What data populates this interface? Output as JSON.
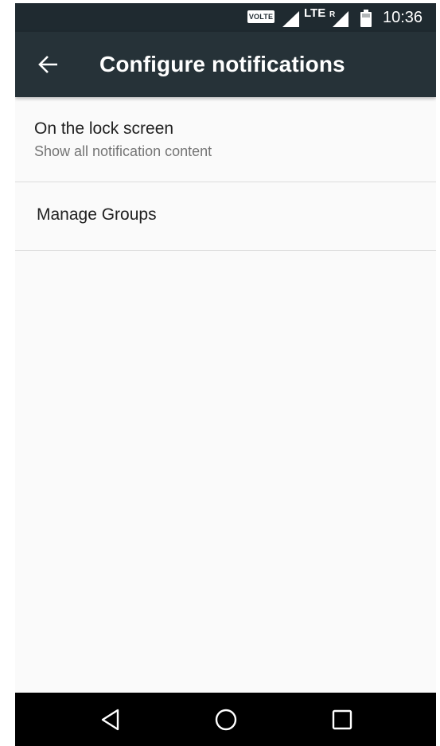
{
  "status_bar": {
    "volte_label": "VOLTE",
    "network_label": "LTE",
    "roaming_label": "R",
    "time": "10:36",
    "icons": [
      "volte-badge",
      "signal-icon",
      "roaming-signal-icon",
      "battery-icon"
    ]
  },
  "app_bar": {
    "back_icon": "arrow-left-icon",
    "title": "Configure notifications",
    "background_color": "#263238"
  },
  "settings": [
    {
      "title": "On the lock screen",
      "summary": "Show all notification content"
    },
    {
      "title": "Manage Groups"
    }
  ],
  "nav_bar": {
    "icons": [
      "back-triangle-icon",
      "home-circle-icon",
      "recents-square-icon"
    ]
  }
}
